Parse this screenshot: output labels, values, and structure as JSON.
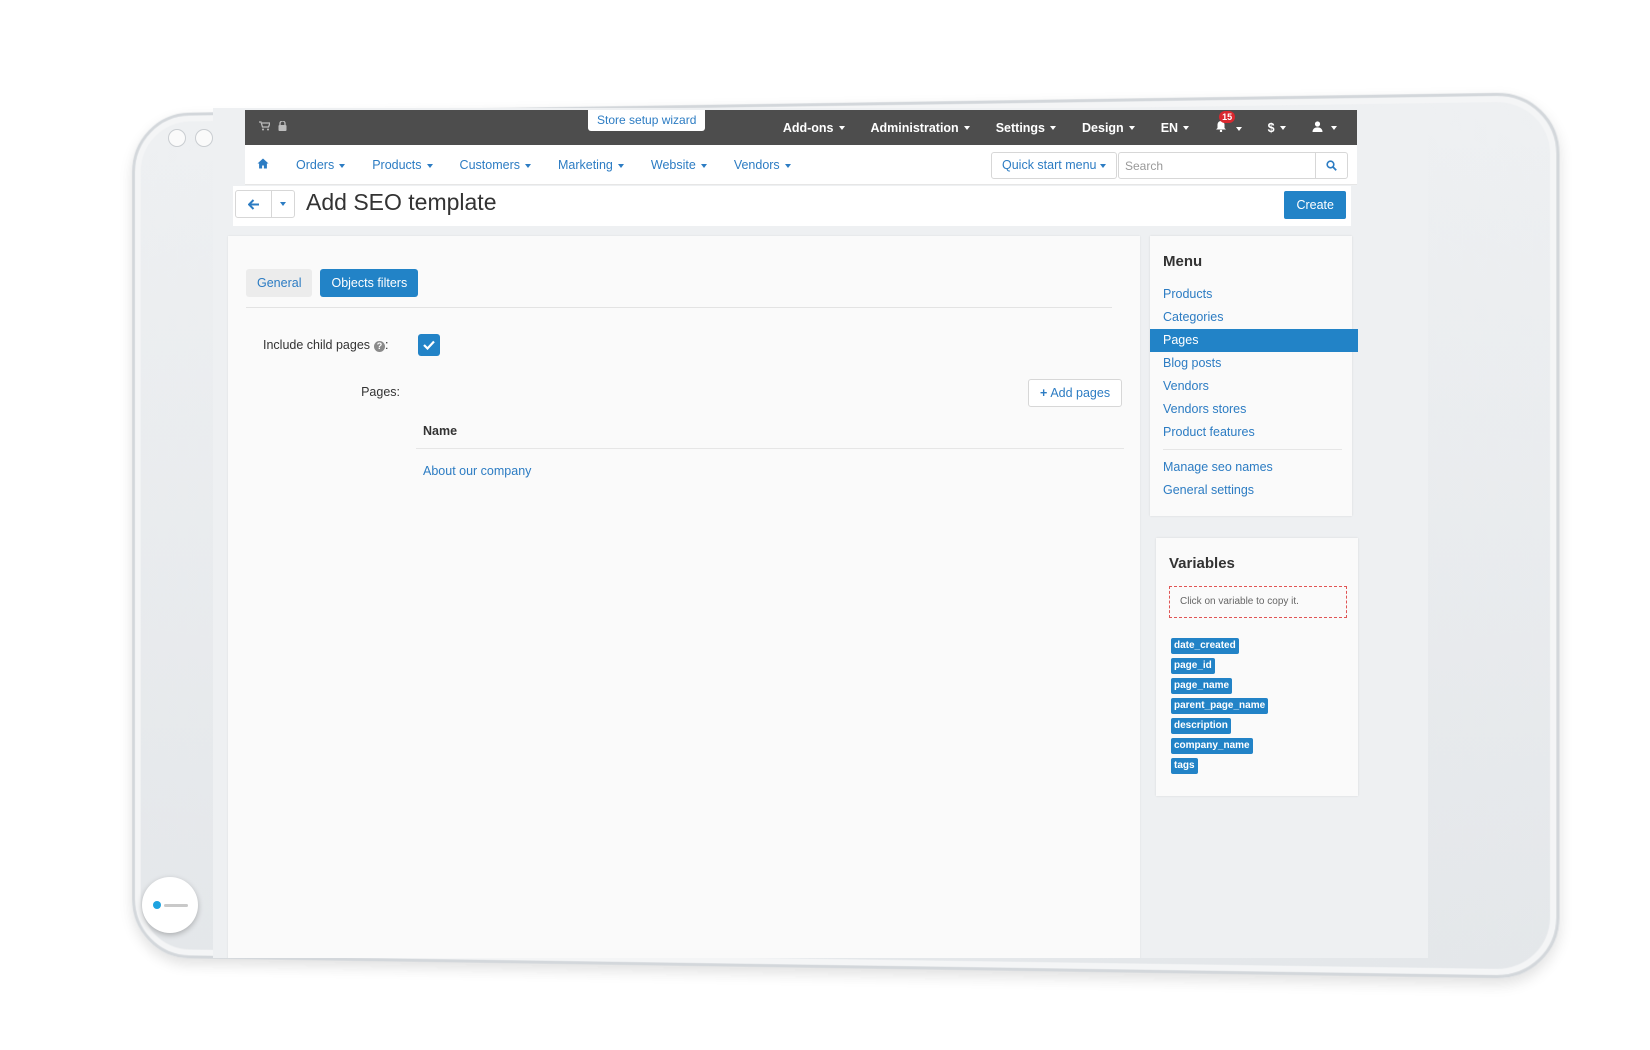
{
  "topbar": {
    "wizard": "Store setup wizard",
    "menu": [
      "Add-ons",
      "Administration",
      "Settings",
      "Design",
      "EN"
    ],
    "notifications_count": "15",
    "currency": "$"
  },
  "navbar": {
    "items": [
      "Orders",
      "Products",
      "Customers",
      "Marketing",
      "Website",
      "Vendors"
    ],
    "quick_start": "Quick start menu",
    "search_placeholder": "Search"
  },
  "titlebar": {
    "title": "Add SEO template",
    "create": "Create"
  },
  "content": {
    "tabs": [
      "General",
      "Objects filters"
    ],
    "include_child_label": "Include child pages",
    "include_child_checked": true,
    "pages_label": "Pages:",
    "add_pages": "Add pages",
    "name_header": "Name",
    "pages": [
      "About our company"
    ]
  },
  "menu": {
    "title": "Menu",
    "items": [
      "Products",
      "Categories",
      "Pages",
      "Blog posts",
      "Vendors",
      "Vendors stores",
      "Product features"
    ],
    "items2": [
      "Manage seo names",
      "General settings"
    ],
    "active": "Pages"
  },
  "variables": {
    "title": "Variables",
    "hint": "Click on variable to copy it.",
    "items": [
      "date_created",
      "page_id",
      "page_name",
      "parent_page_name",
      "description",
      "company_name",
      "tags"
    ]
  },
  "colors": {
    "accent": "#2283c7",
    "topbar": "#4d4d4d",
    "link": "#2c7cc3"
  }
}
